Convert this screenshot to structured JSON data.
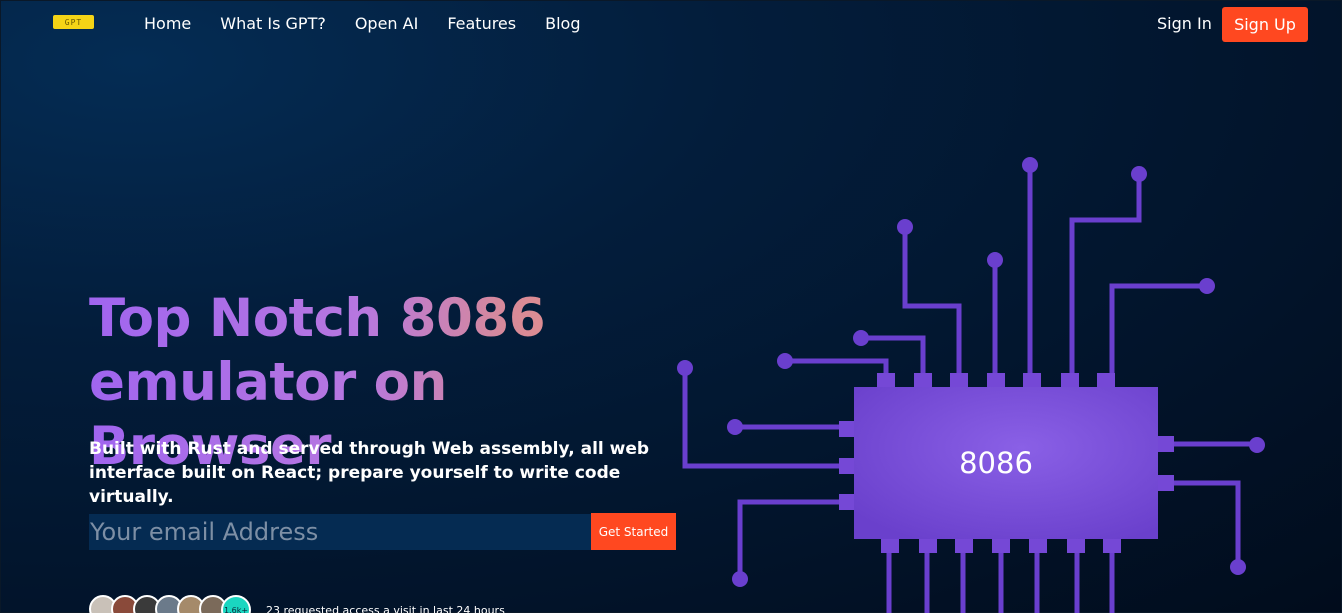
{
  "nav": {
    "logo_text": "GPT",
    "links": [
      "Home",
      "What Is GPT?",
      "Open AI",
      "Features",
      "Blog"
    ],
    "signin": "Sign In",
    "signup": "Sign Up"
  },
  "hero": {
    "headline": "Top Notch 8086 emulator on Browser",
    "subtext": "Built with Rust and served through Web assembly, all web interface built on React; prepare yourself to write code virtually.",
    "email_placeholder": "Your email Address",
    "cta": "Get Started",
    "avatar_count": "1.6k+",
    "access_text": "23 requested access a visit in last 24 hours"
  },
  "chip": {
    "label": "8086",
    "color": "#7548d6",
    "trace_color": "#6a3fce"
  },
  "colors": {
    "accent": "#ff4820",
    "gradient_start": "#a065ef",
    "gradient_end": "#f4957c"
  },
  "icons": [
    "logo-icon",
    "cpu-chip-illustration"
  ]
}
